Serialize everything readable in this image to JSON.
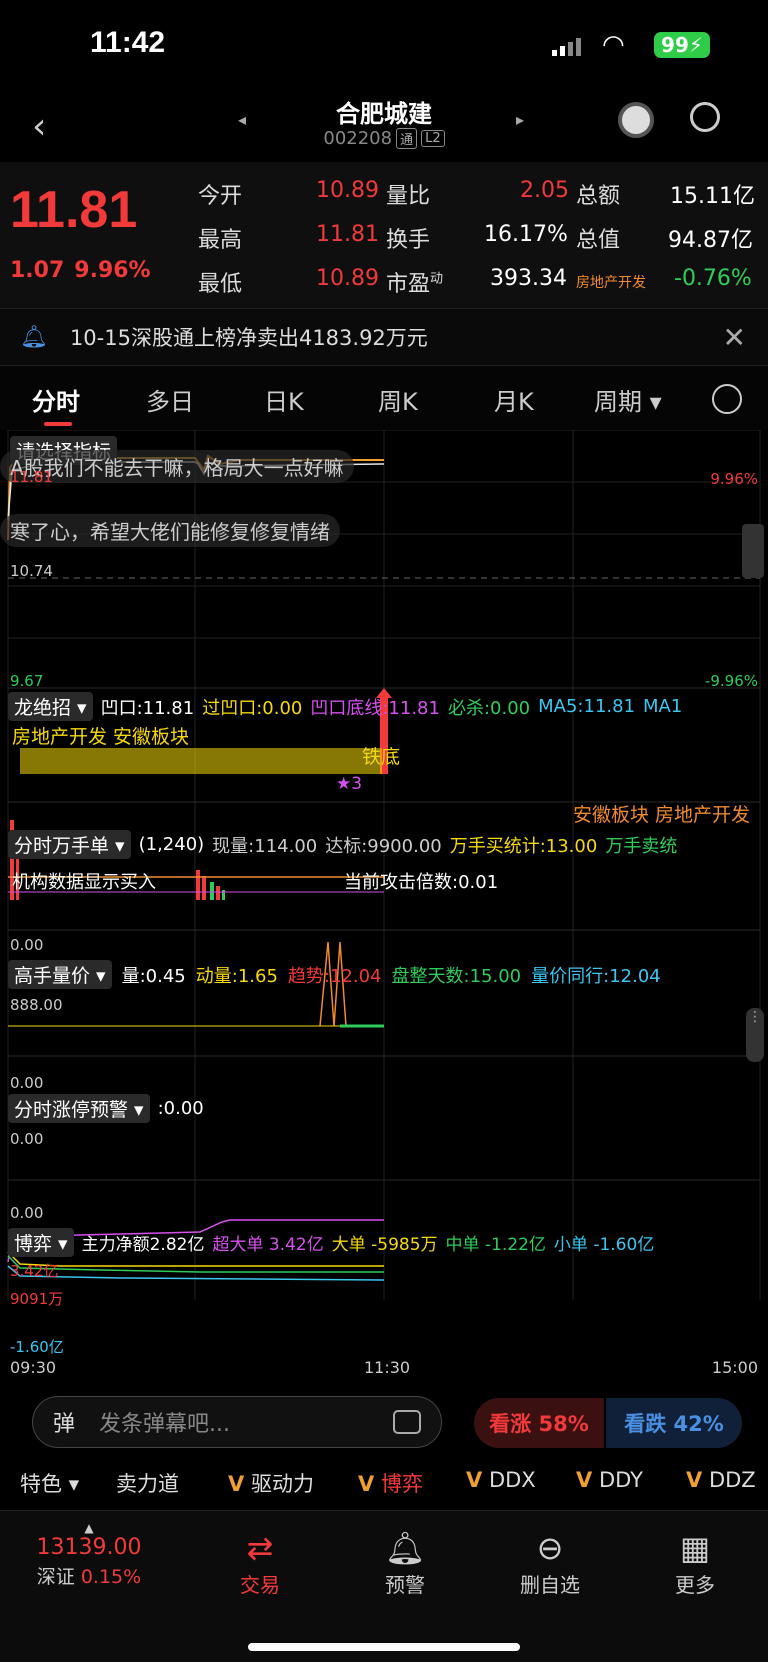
{
  "status": {
    "time": "11:42",
    "battery": "99"
  },
  "nav": {
    "title": "合肥城建",
    "code": "002208",
    "tag_tong": "通",
    "tag_l2": "L2"
  },
  "quote": {
    "price": "11.81",
    "change": "1.07",
    "change_pct": "9.96%",
    "open_label": "今开",
    "open": "10.89",
    "high_label": "最高",
    "high": "11.81",
    "low_label": "最低",
    "low": "10.89",
    "vol_ratio_label": "量比",
    "vol_ratio": "2.05",
    "turnover_label": "换手",
    "turnover": "16.17%",
    "pe_label": "市盈",
    "pe_sup": "动",
    "pe": "393.34",
    "amount_label": "总额",
    "amount": "15.11亿",
    "mktcap_label": "总值",
    "mktcap": "94.87亿",
    "sector": "房地产开发",
    "sector_pct": "-0.76%"
  },
  "news": {
    "text": "10-15深股通上榜净卖出4183.92万元"
  },
  "tabs": [
    "分时",
    "多日",
    "日K",
    "周K",
    "月K",
    "周期"
  ],
  "main_chart": {
    "select_indicator": "请选择指标",
    "danmaku1": "A股我们不能去干嘛，格局大一点好嘛",
    "danmaku2": "寒了心，希望大佬们能修复修复情绪",
    "y_top": "11.81",
    "y_mid": "10.74",
    "y_bot": "9.67",
    "pct_top": "9.96%",
    "pct_bot": "-9.96%"
  },
  "panel1": {
    "name": "龙绝招",
    "ao": "凹口:11.81",
    "guo": "过凹口:0.00",
    "di": "凹口底线:11.81",
    "bisha": "必杀:0.00",
    "ma5": "MA5:11.81",
    "ma1": "MA1",
    "sector_tags": "房地产开发 安徽板块",
    "tiedi": "铁底",
    "star": "★3",
    "sector_tags_right": "安徽板块 房地产开发"
  },
  "panel2": {
    "name": "分时万手单",
    "params": "(1,240)",
    "xian": "现量:114.00",
    "dabiao": "达标:9900.00",
    "buy": "万手买统计:13.00",
    "sell": "万手卖统",
    "overlay": "机构数据显示买入",
    "gongji": "当前攻击倍数:0.01",
    "zero": "0.00"
  },
  "panel3": {
    "name": "高手量价",
    "liang": "量:0.45",
    "dong": "动量:1.65",
    "qushi": "趋势:12.04",
    "panzheng": "盘整天数:15.00",
    "tongxing": "量价同行:12.04",
    "y_top": "888.00",
    "y_bot": "0.00"
  },
  "panel4": {
    "name": "分时涨停预警",
    "val": ":0.00",
    "y_top": "0.00",
    "y_bot": "0.00"
  },
  "panel5": {
    "name": "博弈",
    "zhuli": "主力净额2.82亿",
    "chaoda": "超大单 3.42亿",
    "da": "大单 -5985万",
    "zhong": "中单 -1.22亿",
    "xiao": "小单 -1.60亿",
    "y1": "3.42亿",
    "y2": "9091万",
    "y3": "-1.60亿"
  },
  "time_axis": [
    "09:30",
    "11:30",
    "15:00"
  ],
  "comment": {
    "dan": "弹",
    "placeholder": "发条弹幕吧...",
    "bull": "看涨 58%",
    "bear": "看跌 42%"
  },
  "indicators": [
    "特色",
    "卖力道",
    "驱动力",
    "博弈",
    "DDX",
    "DDY",
    "DDZ"
  ],
  "bottom_nav": {
    "index_value": "13139.00",
    "index_name": "深证",
    "index_pct": "0.15%",
    "trade": "交易",
    "alert": "预警",
    "remove": "删自选",
    "more": "更多"
  },
  "colors": {
    "red": "#f23a3a",
    "green": "#2ecc5b",
    "yellow": "#f5d90a",
    "magenta": "#d84ff0",
    "cyan": "#39c6f2",
    "orange": "#f08a2c"
  }
}
